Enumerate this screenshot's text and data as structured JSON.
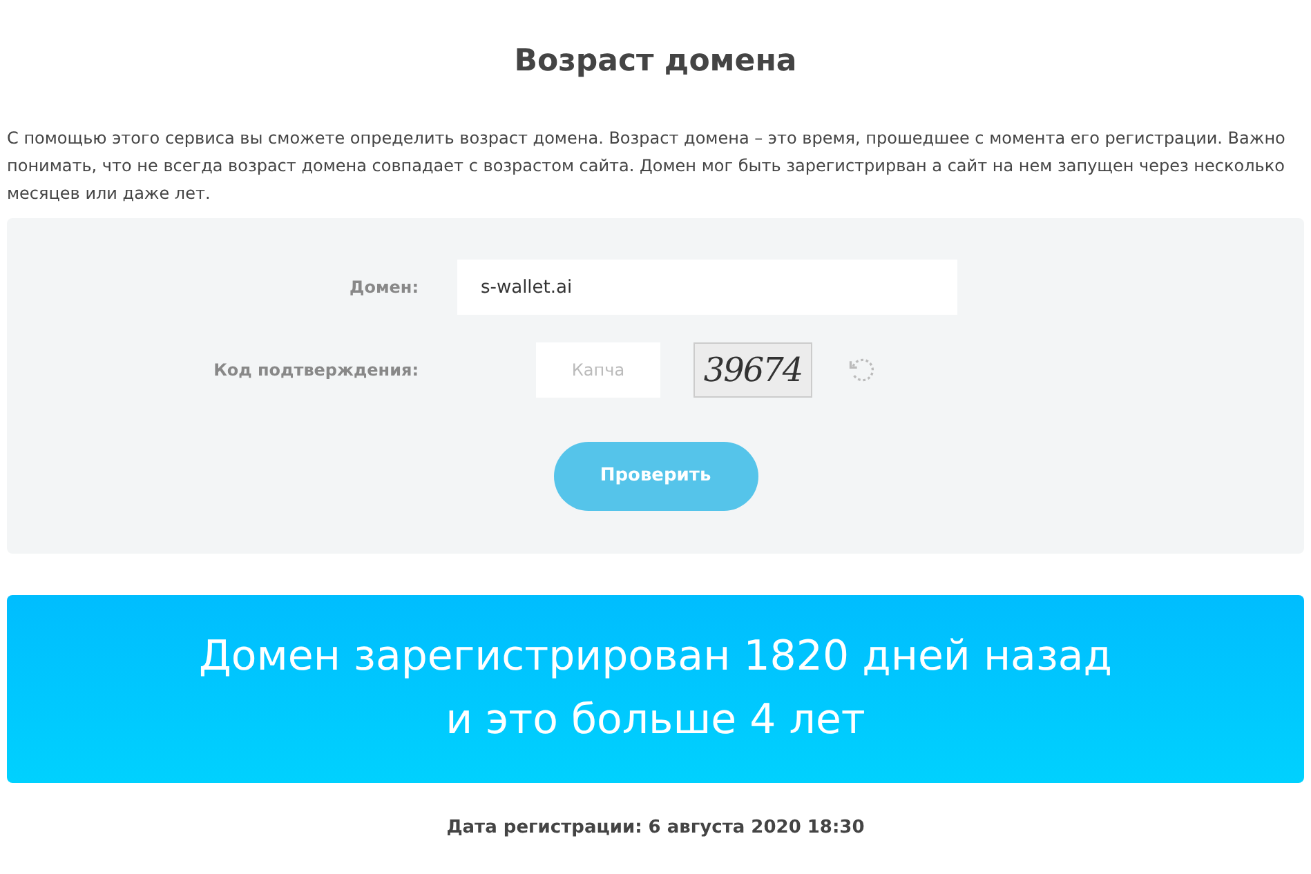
{
  "title": "Возраст домена",
  "description": "С помощью этого сервиса вы сможете определить возраст домена. Возраст домена – это время, прошедшее с момента его регистрации. Важно понимать, что не всегда возраст домена совпадает с возрастом сайта. Домен мог быть зарегистрирван а сайт на нем запущен через несколько месяцев или даже лет.",
  "form": {
    "domain_label": "Домен:",
    "domain_value": "s-wallet.ai",
    "captcha_label": "Код подтверждения:",
    "captcha_placeholder": "Капча",
    "captcha_code": "39674",
    "submit": "Проверить"
  },
  "result": {
    "lines": [
      "Домен зарегистрирован 1820 дней назад",
      "и это больше 4 лет"
    ]
  },
  "registration_date": "Дата регистрации: 6 августа 2020 18:30"
}
